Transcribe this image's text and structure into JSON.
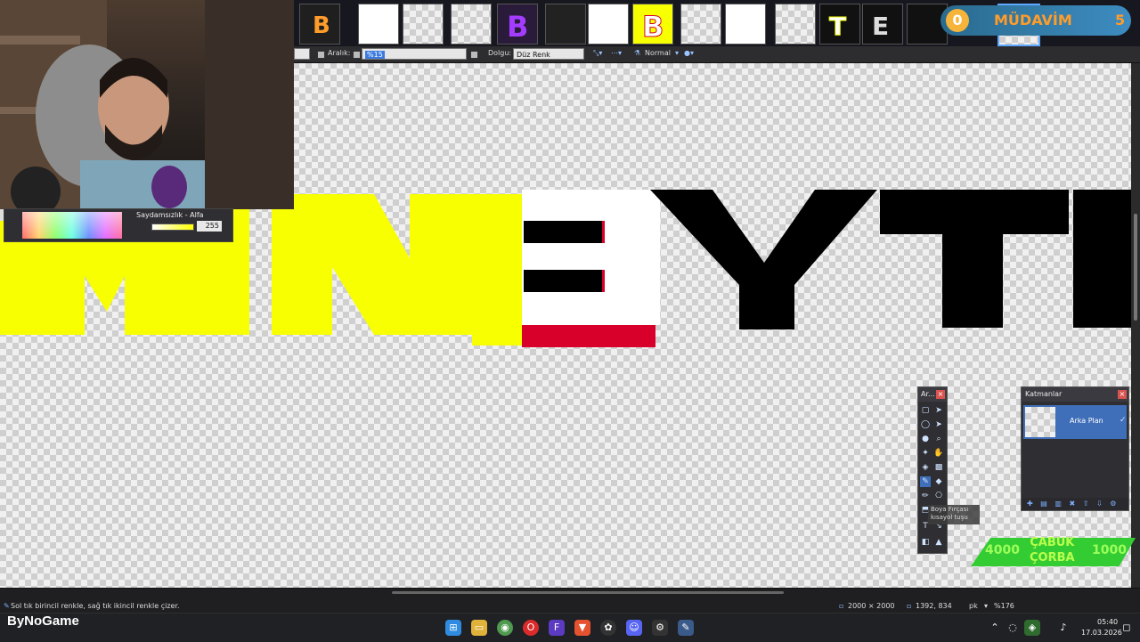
{
  "toolbar": {
    "spacing_label": "Aralık:",
    "spacing_value": "%15",
    "fill_label": "Dolgu:",
    "fill_value": "Düz Renk",
    "blend_mode": "Normal"
  },
  "color_panel": {
    "alpha_label": "Saydamsızlık - Alfa",
    "alpha_value": "255"
  },
  "canvas": {
    "letters": [
      "M",
      "N",
      "B",
      "Y",
      "T"
    ],
    "colors": {
      "yellow": "#f8ff00",
      "white": "#ffffff",
      "red": "#d8002a",
      "black": "#000000"
    }
  },
  "tools_panel": {
    "title": "Ar...",
    "tooltip_line1": "Boya Fırçası",
    "tooltip_line2": "kısayol tuşu"
  },
  "layers_panel": {
    "title": "Katmanlar",
    "layer_name": "Arka Plan"
  },
  "overlays": {
    "mudavim_count": "0",
    "mudavim_label": "MÜDAVİM",
    "mudavim_number": "5",
    "corba_left": "4000",
    "corba_title_line1": "ÇABUK",
    "corba_title_line2": "ÇORBA",
    "corba_right": "1000"
  },
  "status": {
    "hint": "Sol tık birincil renkle, sağ tık ikincil renkle çizer.",
    "image_size": "2000 × 2000",
    "cursor_pos": "1392, 834",
    "unit": "pk",
    "zoom": "%176"
  },
  "taskbar": {
    "brand": "ByNoGame",
    "time": "05:40",
    "date": "17.03.2026"
  }
}
